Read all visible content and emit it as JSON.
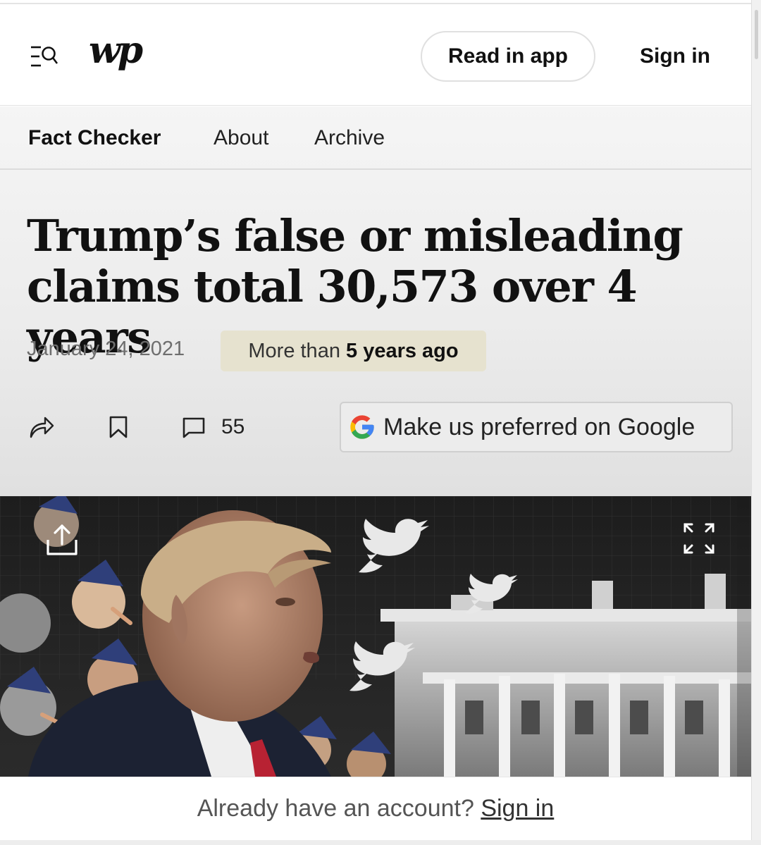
{
  "header": {
    "logo_text": "wp",
    "read_in_app": "Read in app",
    "sign_in": "Sign in"
  },
  "subnav": {
    "items": [
      {
        "label": "Fact Checker"
      },
      {
        "label": "About"
      },
      {
        "label": "Archive"
      }
    ]
  },
  "article": {
    "headline": "Trump’s false or misleading claims total 30,573 over 4 years",
    "date": "January 24, 2021",
    "age_prefix": "More than ",
    "age_emphasis": "5 years ago",
    "comment_count": "55",
    "google_preferred": "Make us preferred on Google"
  },
  "icons": {
    "menu": "menu-search-icon",
    "share": "share-arrow-icon",
    "bookmark": "bookmark-icon",
    "comment": "comment-icon",
    "google": "google-g-icon",
    "image_share": "upload-share-icon",
    "image_expand": "expand-icon"
  },
  "footer": {
    "prompt": "Already have an account? ",
    "sign_in_link": "Sign in"
  },
  "colors": {
    "badge_bg": "#e6e2cf",
    "google_blue": "#4285F4",
    "google_red": "#EA4335",
    "google_yellow": "#FBBC05",
    "google_green": "#34A853"
  }
}
